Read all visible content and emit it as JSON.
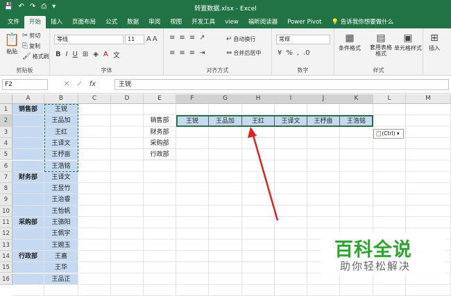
{
  "window": {
    "title": "转置数据.xlsx - Excel"
  },
  "qat": [
    "💾",
    "↶",
    "↷",
    "⎙",
    "▾"
  ],
  "tabs": [
    "文件",
    "开始",
    "插入",
    "页面布局",
    "公式",
    "数据",
    "审阅",
    "视图",
    "开发工具",
    "view",
    "福昕阅读器",
    "Power Pivot",
    "告诉我你想要做什么"
  ],
  "ribbon": {
    "clipboard": {
      "paste": "粘贴",
      "cut": "剪切",
      "copy": "复制",
      "format_painter": "格式刷",
      "label": "剪贴板"
    },
    "font": {
      "name": "等线",
      "size": "11",
      "label": "字体"
    },
    "alignment": {
      "wrap": "自动换行",
      "merge": "合并后居中",
      "label": "对齐方式"
    },
    "number": {
      "format": "常规",
      "label": "数字"
    },
    "styles": {
      "conditional": "条件格式",
      "table": "套用表格格式",
      "cell": "单元格样式",
      "label": "样式"
    },
    "cells": {
      "insert": "插入"
    }
  },
  "formula_bar": {
    "name_box": "F2",
    "fx": "fx",
    "content": "王锐"
  },
  "columns": [
    "A",
    "B",
    "C",
    "D",
    "E",
    "F",
    "G",
    "H",
    "I",
    "J",
    "K",
    "L",
    "M"
  ],
  "rows": [
    "1",
    "2",
    "3",
    "4",
    "5",
    "6",
    "7",
    "8",
    "9",
    "10",
    "11",
    "12",
    "13",
    "14",
    "15",
    "16"
  ],
  "colA": [
    "销售部",
    "",
    "",
    "",
    "",
    "",
    "财务部",
    "",
    "",
    "",
    "采购部",
    "",
    "",
    "行政部",
    "",
    ""
  ],
  "colB": [
    "王锐",
    "王品加",
    "王红",
    "王译文",
    "王杼亩",
    "王浩铭",
    "王译文",
    "王昱竹",
    "王治睿",
    "王怡帆",
    "王骆阳",
    "王佩宇",
    "王婉玉",
    "王嘉",
    "王华",
    "王品正"
  ],
  "colE": [
    "",
    "销售部",
    "财务部",
    "采购部",
    "行政部"
  ],
  "transposed": [
    "王锐",
    "王品加",
    "王红",
    "王译文",
    "王杼亩",
    "王浩铭"
  ],
  "paste_ctrl": "(Ctrl)",
  "watermark": {
    "line1": "百科全说",
    "line2": "助你轻松解决"
  },
  "colors": {
    "accent": "#217346",
    "fill": "#c5d9f1",
    "arrow": "#e02020"
  }
}
